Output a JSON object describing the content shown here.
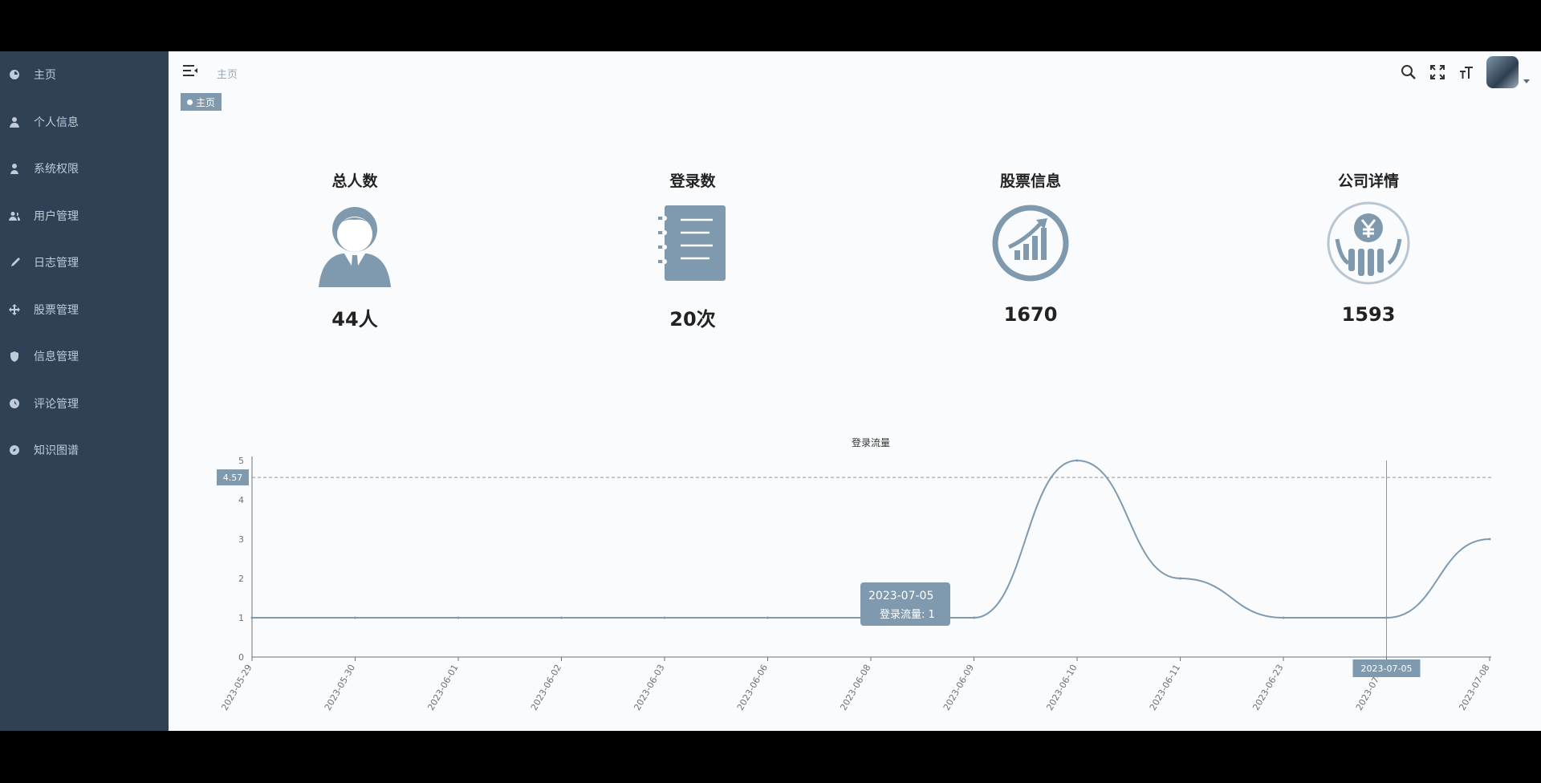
{
  "sidebar": {
    "items": [
      {
        "label": "主页",
        "icon": "dashboard-icon"
      },
      {
        "label": "个人信息",
        "icon": "user-icon"
      },
      {
        "label": "系统权限",
        "icon": "lock-user-icon"
      },
      {
        "label": "用户管理",
        "icon": "users-icon"
      },
      {
        "label": "日志管理",
        "icon": "pen-icon"
      },
      {
        "label": "股票管理",
        "icon": "move-icon"
      },
      {
        "label": "信息管理",
        "icon": "shield-icon"
      },
      {
        "label": "评论管理",
        "icon": "clock-icon"
      },
      {
        "label": "知识图谱",
        "icon": "compass-icon"
      }
    ]
  },
  "header": {
    "breadcrumb": "主页",
    "icons": [
      "search-icon",
      "fullscreen-icon",
      "font-size-icon"
    ]
  },
  "tags": {
    "active": "主页"
  },
  "cards": [
    {
      "title": "总人数",
      "value": "44人",
      "icon": "businessman-icon"
    },
    {
      "title": "登录数",
      "value": "20次",
      "icon": "notebook-icon"
    },
    {
      "title": "股票信息",
      "value": "1670",
      "icon": "growth-chart-icon"
    },
    {
      "title": "公司详情",
      "value": "1593",
      "icon": "yuan-finance-icon"
    }
  ],
  "colors": {
    "sidebar_bg": "#304156",
    "sidebar_text": "#bfcbd9",
    "accent": "#7f9aae"
  },
  "chart_data": {
    "type": "line",
    "title": "登录流量",
    "categories": [
      "2023-05-29",
      "2023-05-30",
      "2023-06-01",
      "2023-06-02",
      "2023-06-03",
      "2023-06-06",
      "2023-06-08",
      "2023-06-09",
      "2023-06-10",
      "2023-06-11",
      "2023-06-23",
      "2023-07-05",
      "2023-07-08"
    ],
    "series": [
      {
        "values": [
          1,
          1,
          1,
          1,
          1,
          1,
          1,
          1,
          5,
          2,
          1,
          1,
          3
        ]
      }
    ],
    "ylim": [
      0,
      5
    ],
    "yticks": [
      0,
      1,
      2,
      3,
      4,
      5
    ],
    "smooth": true,
    "crosshair": {
      "y_label": "4.57",
      "x_label": "2023-07-05"
    },
    "tooltip": {
      "date": "2023-07-05",
      "text": "登录流量: 1"
    },
    "grid": false
  }
}
